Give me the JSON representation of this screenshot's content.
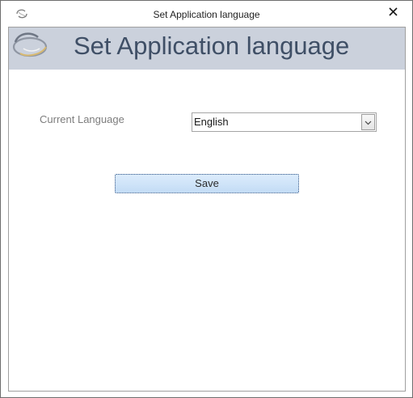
{
  "window": {
    "title": "Set Application language",
    "app_icon": "app-logo-icon",
    "close_icon": "close-icon"
  },
  "header": {
    "title": "Set Application language",
    "logo": "app-logo-icon",
    "background": "#cbd1dc",
    "title_color": "#3f4f66"
  },
  "form": {
    "language_label": "Current Language",
    "language_value": "English",
    "dropdown_icon": "chevron-down-icon"
  },
  "actions": {
    "save_label": "Save"
  }
}
